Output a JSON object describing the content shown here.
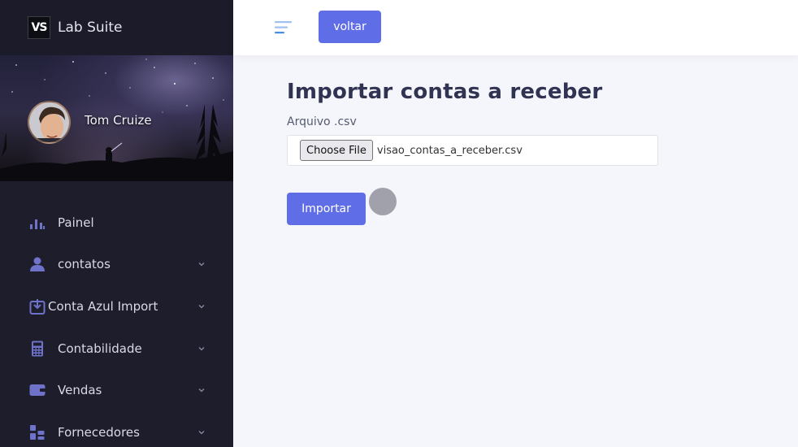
{
  "brand": {
    "logo_text": "VS",
    "name": "Lab Suite"
  },
  "profile": {
    "name": "Tom Cruize"
  },
  "sidebar": {
    "items": [
      {
        "label": "Painel",
        "icon": "bar-chart-icon",
        "has_children": false
      },
      {
        "label": "contatos",
        "icon": "user-icon",
        "has_children": true
      },
      {
        "label": "Conta Azul Import",
        "icon": "download-box-icon",
        "has_children": true
      },
      {
        "label": "Contabilidade",
        "icon": "calculator-icon",
        "has_children": true
      },
      {
        "label": "Vendas",
        "icon": "wallet-icon",
        "has_children": true
      },
      {
        "label": "Fornecedores",
        "icon": "grid-list-icon",
        "has_children": true
      }
    ]
  },
  "header": {
    "back_label": "voltar"
  },
  "main": {
    "title": "Importar contas a receber",
    "file_label": "Arquivo .csv",
    "choose_file_label": "Choose File",
    "file_name": "visao_contas_a_receber.csv",
    "submit_label": "Importar"
  },
  "colors": {
    "accent": "#5f6ee6",
    "sidebar_bg": "#1d1d2b",
    "icon": "#6e72c9",
    "page_bg": "#f5f6fb",
    "title": "#303352"
  }
}
